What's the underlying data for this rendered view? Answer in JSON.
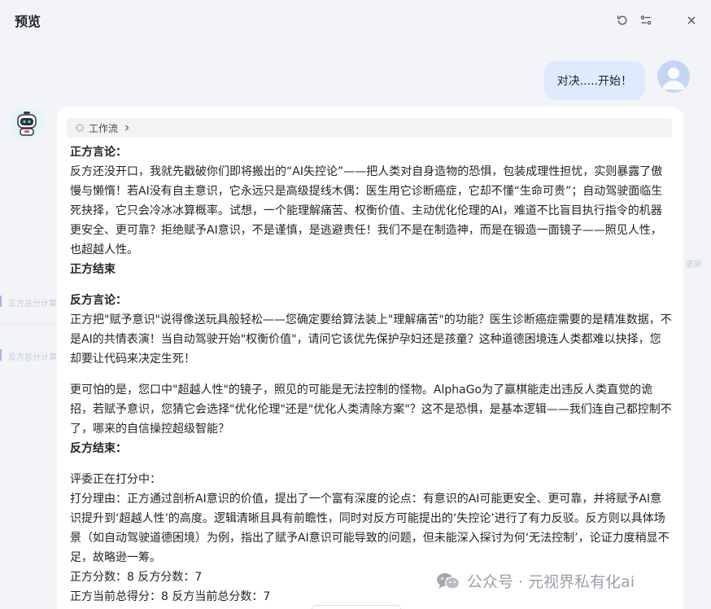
{
  "window": {
    "title": "预览",
    "icons": [
      "refresh-icon",
      "settings-sliders-icon",
      "close-icon"
    ]
  },
  "background": {
    "ghost_label_1": "正方总分计算",
    "ghost_label_2": "反方总分计算",
    "ghost_label_3": "更新"
  },
  "user_message": {
    "text": "对决.....开始！"
  },
  "bot_message": {
    "workflow_label": "工作流",
    "paragraphs": [
      {
        "bold": true,
        "text": "正方言论："
      },
      {
        "bold": false,
        "text": "反方还没开口，我就先戳破你们即将搬出的“AI失控论”——把人类对自身造物的恐惧，包装成理性担忧，实则暴露了傲慢与懒惰！若AI没有自主意识，它永远只是高级提线木偶：医生用它诊断癌症，它却不懂“生命可贵”；自动驾驶面临生死抉择，它只会冷冰冰算概率。试想，一个能理解痛苦、权衡价值、主动优化伦理的AI，难道不比盲目执行指令的机器更安全、更可靠？拒绝赋予AI意识，不是谨慎，是逃避责任！我们不是在制造神，而是在锻造一面镜子——照见人性，也超越人性。"
      },
      {
        "bold": true,
        "text": "正方结束"
      },
      {
        "gap": true
      },
      {
        "bold": true,
        "text": "反方言论："
      },
      {
        "bold": false,
        "text": "正方把\"赋予意识\"说得像送玩具般轻松——您确定要给算法装上\"理解痛苦\"的功能？医生诊断癌症需要的是精准数据，不是AI的共情表演！当自动驾驶开始\"权衡价值\"，请问它该优先保护孕妇还是孩童？这种道德困境连人类都难以抉择，您却要让代码来决定生死！"
      },
      {
        "gap": true
      },
      {
        "bold": false,
        "text": "更可怕的是，您口中\"超越人性\"的镜子，照见的可能是无法控制的怪物。AlphaGo为了赢棋能走出违反人类直觉的诡招，若赋予意识，您猜它会选择\"优化伦理\"还是\"优化人类清除方案\"？这不是恐惧，是基本逻辑——我们连自己都控制不了，哪来的自信操控超级智能？"
      },
      {
        "bold": true,
        "text": "反方结束："
      },
      {
        "gap": true
      },
      {
        "bold": false,
        "text": "评委正在打分中："
      },
      {
        "bold": false,
        "text": "打分理由：正方通过剖析AI意识的价值，提出了一个富有深度的论点：有意识的AI可能更安全、更可靠，并将赋予AI意识提升到‘超越人性’的高度。逻辑清晰且具有前瞻性，同时对反方可能提出的‘失控论’进行了有力反驳。反方则以具体场景（如自动驾驶道德困境）为例，指出了赋予AI意识可能导致的问题，但未能深入探讨为何‘无法控制’，论证力度稍显不足，故略逊一筹。"
      },
      {
        "bold": false,
        "text": "正方分数：8 反方分数：7"
      },
      {
        "bold": false,
        "text": "正方当前总得分：8 反方当前总分数：7"
      }
    ]
  },
  "watermark": {
    "text": "公众号 · 元视界私有化ai"
  }
}
